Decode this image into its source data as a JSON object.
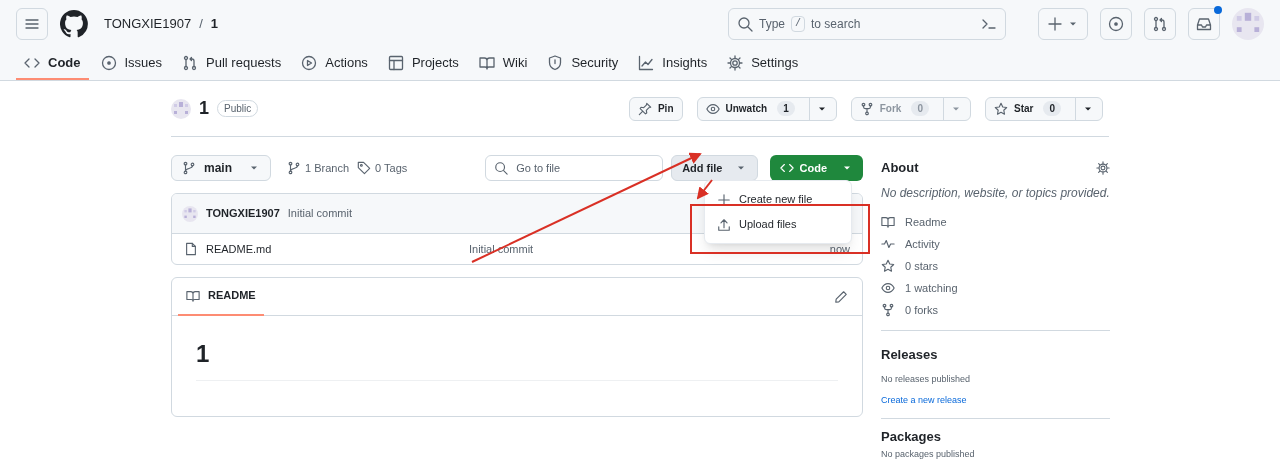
{
  "header": {
    "owner": "TONGXIE1907",
    "separator": "/",
    "repo": "1",
    "search": {
      "before": "Type",
      "key": "/",
      "after": "to search"
    },
    "has_notification": true
  },
  "tabs": [
    {
      "label": "Code",
      "kind": "code",
      "selected": true
    },
    {
      "label": "Issues",
      "kind": "issue",
      "selected": false
    },
    {
      "label": "Pull requests",
      "kind": "pr",
      "selected": false
    },
    {
      "label": "Actions",
      "kind": "play",
      "selected": false
    },
    {
      "label": "Projects",
      "kind": "table",
      "selected": false
    },
    {
      "label": "Wiki",
      "kind": "book",
      "selected": false
    },
    {
      "label": "Security",
      "kind": "shield",
      "selected": false
    },
    {
      "label": "Insights",
      "kind": "graph",
      "selected": false
    },
    {
      "label": "Settings",
      "kind": "gear",
      "selected": false
    }
  ],
  "repo": {
    "name": "1",
    "visibility": "Public",
    "actions": [
      {
        "kind": "pin",
        "label": "Pin",
        "disabled": false
      },
      {
        "kind": "watch",
        "label": "Unwatch",
        "count": "1",
        "disabled": false
      },
      {
        "kind": "fork",
        "label": "Fork",
        "count": "0",
        "disabled": true
      },
      {
        "kind": "star",
        "label": "Star",
        "count": "0",
        "disabled": false
      }
    ]
  },
  "toolbar": {
    "branch": "main",
    "branches": "1 Branch",
    "tags": "0 Tags",
    "go_to_file": {
      "placeholder": "Go to file"
    },
    "add_file": "Add file",
    "code": "Code"
  },
  "add_file_menu": [
    {
      "kind": "plus",
      "label": "Create new file"
    },
    {
      "kind": "upload",
      "label": "Upload files"
    }
  ],
  "commit": {
    "author": "TONGXIE1907",
    "message": "Initial commit"
  },
  "files": [
    {
      "name": "README.md",
      "message": "Initial commit",
      "time": "now"
    }
  ],
  "readme": {
    "tab": "README",
    "heading": "1"
  },
  "about": {
    "title": "About",
    "description": "No description, website, or topics provided.",
    "links": [
      {
        "kind": "book",
        "label": "Readme"
      },
      {
        "kind": "pulse",
        "label": "Activity"
      },
      {
        "kind": "star",
        "label": "0 stars"
      },
      {
        "kind": "eye",
        "label": "1 watching"
      },
      {
        "kind": "fork",
        "label": "0 forks"
      }
    ]
  },
  "releases": {
    "title": "Releases",
    "text": "No releases published",
    "link": "Create a new release"
  },
  "packages": {
    "title": "Packages",
    "text": "No packages published"
  }
}
